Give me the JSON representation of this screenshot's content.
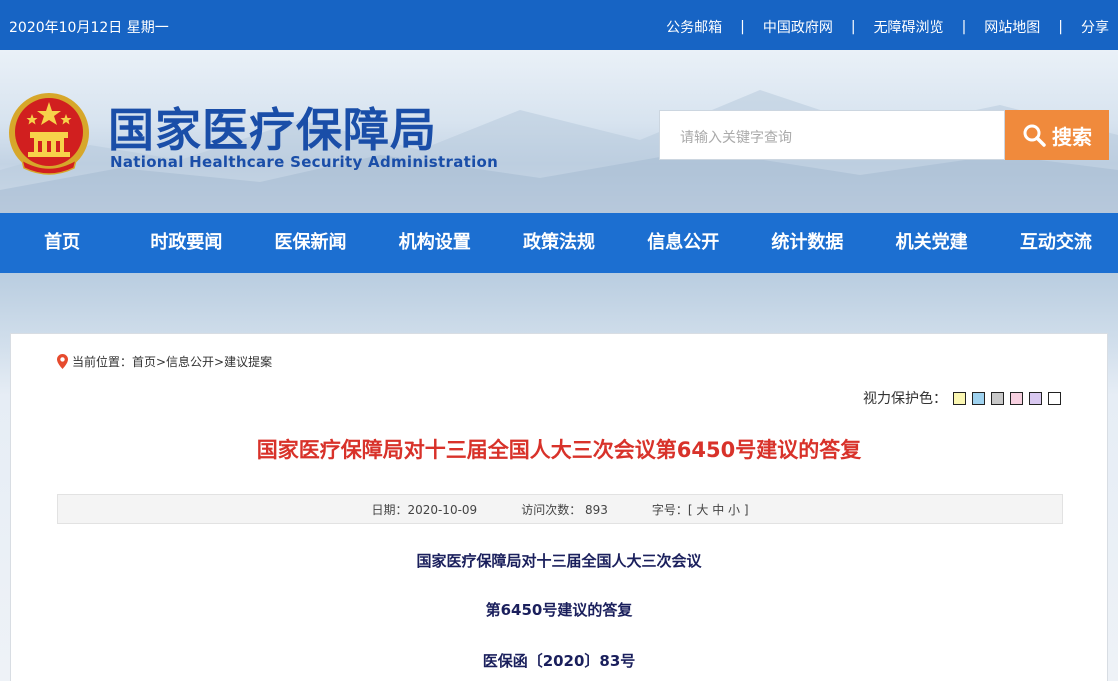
{
  "topbar": {
    "date": "2020年10月12日 星期一",
    "links": [
      "公务邮箱",
      "中国政府网",
      "无障碍浏览",
      "网站地图",
      "分享"
    ],
    "separator": "|"
  },
  "header": {
    "logo_cn": "国家医疗保障局",
    "logo_en": "National Healthcare Security Administration",
    "search_placeholder": "请输入关键字查询",
    "search_button": "搜索"
  },
  "nav": [
    "首页",
    "时政要闻",
    "医保新闻",
    "机构设置",
    "政策法规",
    "信息公开",
    "统计数据",
    "机关党建",
    "互动交流"
  ],
  "breadcrumb": "当前位置：首页>信息公开>建议提案",
  "eyecare": {
    "label": "视力保护色：",
    "colors": [
      "#fbf7b2",
      "#9fd2ef",
      "#c8c8c8",
      "#f7d0e0",
      "#d9c8f0",
      "#ffffff"
    ]
  },
  "article": {
    "title": "国家医疗保障局对十三届全国人大三次会议第6450号建议的答复",
    "date_label": "日期：2020-10-09",
    "visits_label": "访问次数：  893",
    "font_label": "字号：[ 大 中 小 ]",
    "lines": [
      "国家医疗保障局对十三届全国人大三次会议",
      "第6450号建议的答复",
      "医保函〔2020〕83号"
    ]
  },
  "colors": {
    "topbar": "#1764c4",
    "nav": "#1c6fd1",
    "title_red": "#d8322a",
    "search_orange": "#f08a3c"
  }
}
